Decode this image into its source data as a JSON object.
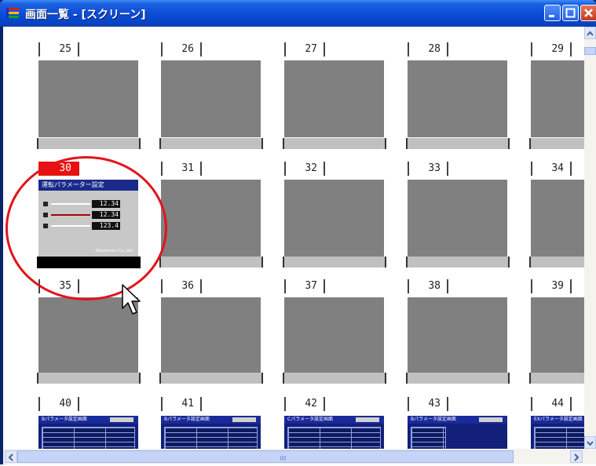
{
  "window": {
    "title": "画面一覧 - [スクリーン]"
  },
  "rows": [
    {
      "labels": [
        "25",
        "26",
        "27",
        "28",
        "29"
      ]
    },
    {
      "labels": [
        "30",
        "31",
        "32",
        "33",
        "34"
      ]
    },
    {
      "labels": [
        "35",
        "36",
        "37",
        "38",
        "39"
      ]
    },
    {
      "labels": [
        "40",
        "41",
        "42",
        "43",
        "44"
      ]
    }
  ],
  "selected_screen": "30",
  "screen30": {
    "header": "運転パラメーター設定",
    "values": [
      "12.34",
      "12.34",
      "123.4"
    ],
    "footer": "Electronics Co.,Ltd."
  },
  "mini_headers": [
    "Bパラメータ設定画面",
    "Bパラメータ設定画面",
    "Cパラメータ設定画面",
    "Bパラメータ設定画面",
    "EXパラメータ設定画面"
  ],
  "colors": {
    "selection": "#e81010",
    "titlebar": "#0a4cd6",
    "thumbnail": "#808080"
  }
}
